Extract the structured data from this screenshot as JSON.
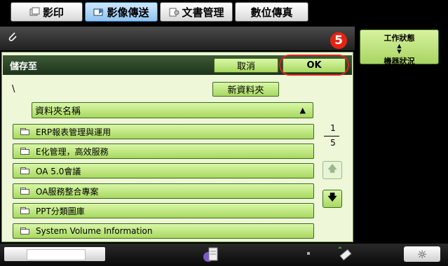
{
  "tabs": [
    {
      "label": "影印",
      "icon": "copy-icon",
      "active": false
    },
    {
      "label": "影像傳送",
      "icon": "image-send-icon",
      "active": true
    },
    {
      "label": "文書管理",
      "icon": "document-filing-icon",
      "active": false
    },
    {
      "label": "數位傳真",
      "icon": "",
      "active": false
    }
  ],
  "dialog": {
    "title": "儲存至",
    "cancel_label": "取消",
    "ok_label": "OK",
    "path": "\\",
    "new_folder_label": "新資料夾",
    "column_header": "資料夾名稱",
    "sort_icon": "▲",
    "step_badge": "5",
    "accent_color": "#e52313"
  },
  "folders": [
    "ERP報表管理與運用",
    "E化管理，高效服務",
    "OA 5.0會議",
    "OA服務整合專案",
    "PPT分類圖庫",
    "System Volume Information"
  ],
  "pagination": {
    "current": "1",
    "total": "5"
  },
  "status_panel": {
    "line1": "工作狀態",
    "line2": "機器狀況"
  }
}
